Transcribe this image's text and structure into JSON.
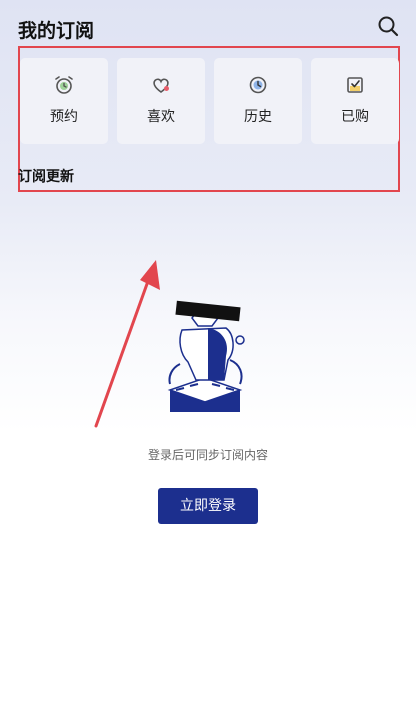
{
  "header": {
    "title": "我的订阅",
    "search_icon": "search-icon"
  },
  "cards": [
    {
      "label": "预约",
      "icon": "alarm-clock-icon"
    },
    {
      "label": "喜欢",
      "icon": "heart-icon"
    },
    {
      "label": "历史",
      "icon": "clock-icon"
    },
    {
      "label": "已购",
      "icon": "purchased-check-icon"
    }
  ],
  "section": {
    "title": "订阅更新"
  },
  "empty_state": {
    "tip": "登录后可同步订阅内容",
    "login_label": "立即登录"
  },
  "colors": {
    "primary": "#1c2f8e",
    "highlight": "#e2464e",
    "accent_green": "#5a9a6b"
  }
}
